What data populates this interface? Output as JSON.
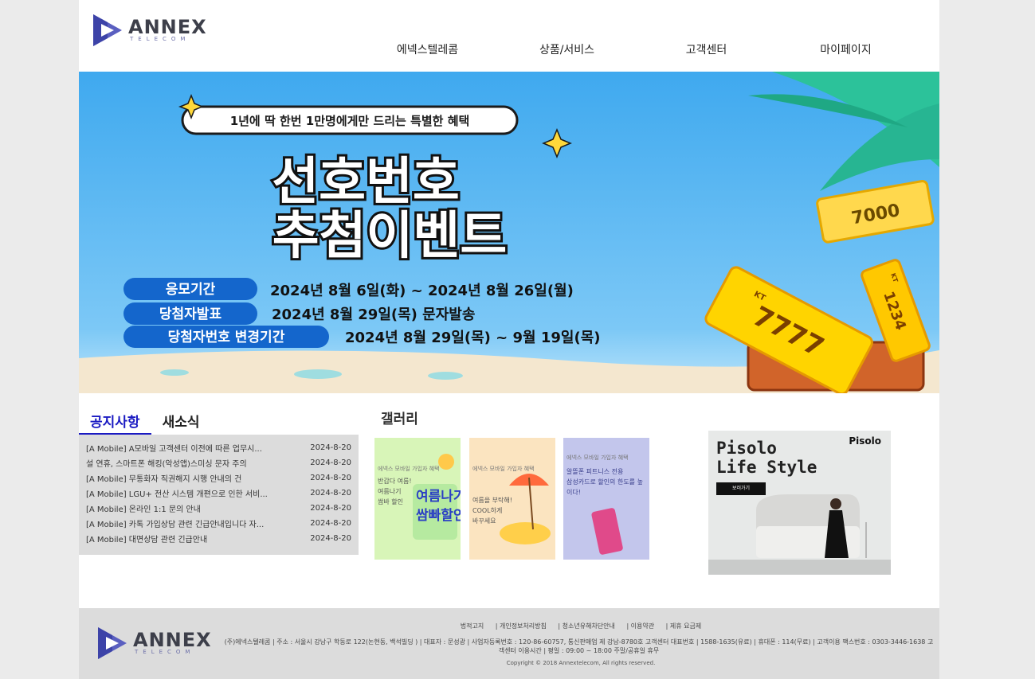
{
  "logo": {
    "brand": "ANNEX",
    "sub": "TELECOM"
  },
  "nav": [
    "에넥스텔레콤",
    "상품/서비스",
    "고객센터",
    "마이페이지"
  ],
  "banner": {
    "ribbon": "1년에 딱 한번 1만명에게만 드리는 특별한 혜택",
    "headline1": "선호번호",
    "headline2": "추첨이벤트",
    "rows": [
      {
        "label": "응모기간",
        "value": "2024년 8월 6일(화) ~ 2024년 8월 26일(월)"
      },
      {
        "label": "당첨자발표",
        "value": "2024년 8월 29일(목) 문자발송"
      },
      {
        "label": "당첨자번호 변경기간",
        "value": "2024년 8월 29일(목) ~ 9월 19일(목)"
      }
    ],
    "ticket_numbers": [
      "7000",
      "7777",
      "1234"
    ],
    "ticket_brand": "KT",
    "colors": {
      "sky": "#4fb2f2",
      "label_bg": "#1466cc",
      "gold": "#f5b800"
    }
  },
  "notice": {
    "tabs": [
      "공지사항",
      "새소식"
    ],
    "items": [
      {
        "title": "[A Mobile] A모바일 고객센터 이전에 따른 업무시...",
        "date": "2024-8-20"
      },
      {
        "title": "설 연휴, 스마트폰 해킹(악성앱)스미싱 문자 주의",
        "date": "2024-8-20"
      },
      {
        "title": "[A Mobile] 무통화자 직권해지 시행 안내의 건",
        "date": "2024-8-20"
      },
      {
        "title": "[A Mobile] LGU+ 전산 시스템 개편으로 인한 서비...",
        "date": "2024-8-20"
      },
      {
        "title": "[A Mobile] 온라인 1:1 문의 안내",
        "date": "2024-8-20"
      },
      {
        "title": "[A Mobile] 카톡 가입상담 관련 긴급안내입니다 자...",
        "date": "2024-8-20"
      },
      {
        "title": "[A Mobile] 대면상담 관련 긴급안내",
        "date": "2024-8-20"
      }
    ]
  },
  "gallery": {
    "title": "갤러리",
    "items": [
      {
        "small": "에넥스 모바일 가입자 혜택",
        "text": "반갑다 여름!\n여름나기\n쌈바 할인",
        "big": "여름나기\n쌈빠할인",
        "bg": "#d8f5b8"
      },
      {
        "small": "에넥스 모바일 가입자 혜택",
        "text": "여름을 부탁해!\nCOOL하게\n바꾸세요",
        "big": "",
        "bg": "#fbe4c0"
      },
      {
        "small": "에넥스 모바일 가입자 혜택",
        "text": "알뜰폰 피트니스 전용\n삼성카드로 할인의 한도를 높이다!",
        "big": "",
        "bg": "#c3c6ec"
      }
    ]
  },
  "ad": {
    "title": "Pisolo\nLife Style",
    "brand": "Pisolo",
    "button": "보러가기"
  },
  "footer": {
    "links": [
      "법적고지",
      "| 개인정보처리방침",
      "| 청소년유해차단안내",
      "| 이용약관",
      "| 제휴 요금제"
    ],
    "info": "(주)에넥스텔레콤 | 주소 : 서울시 강남구 학동로 122(논현동, 백석빌딩 ) | 대표자 : 문성광 | 사업자등록번호 : 120-86-60757, 통신판매업 제 강남-8780호 고객센터 대표번호 | 1588-1635(유료) | 휴대폰 : 114(무료) | 고객이용 팩스번호 : 0303-3446-1638 고객센터 이용시간 | 평일 : 09:00 ~ 18:00 주말/공휴일 휴무",
    "copyright": "Copyright © 2018 Annextelecom, All rights reserved."
  }
}
